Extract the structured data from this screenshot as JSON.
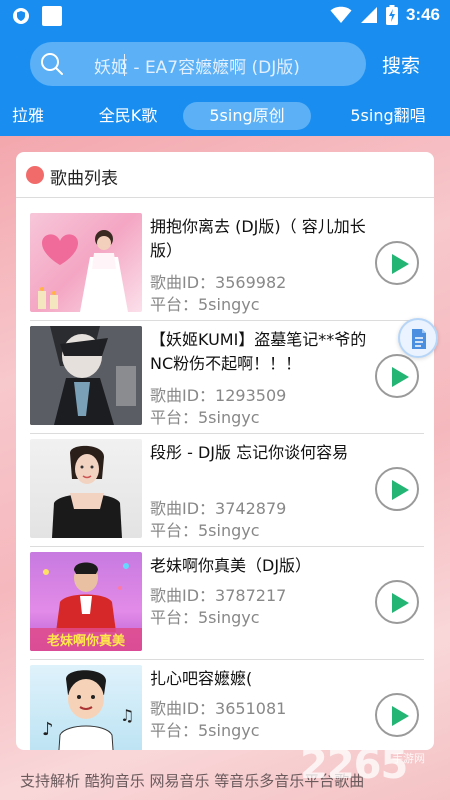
{
  "status_bar": {
    "time": "3:46",
    "icons": [
      "shield-icon",
      "square-icon",
      "wifi-icon",
      "signal-icon",
      "battery-charging-icon"
    ]
  },
  "search": {
    "query": "妖姬 - EA7容嬷嬷啊 (DJ版)",
    "button_label": "搜索",
    "icon": "search-icon"
  },
  "tabs": [
    {
      "label": "拉雅",
      "active": false
    },
    {
      "label": "全民K歌",
      "active": false
    },
    {
      "label": "5sing原创",
      "active": true
    },
    {
      "label": "5sing翻唱",
      "active": false
    }
  ],
  "song_list": {
    "title": "歌曲列表",
    "items": [
      {
        "title": "拥抱你离去 (DJ版)（ 容儿加长版）",
        "id_text": "歌曲ID：3569982",
        "platform_text": "平台：5singyc"
      },
      {
        "title": "【妖姬KUMI】盗墓笔记**爷的NC粉伤不起啊！！！",
        "id_text": "歌曲ID：1293509",
        "platform_text": "平台：5singyc"
      },
      {
        "title": "段彤 - DJ版 忘记你谈何容易",
        "id_text": "歌曲ID：3742879",
        "platform_text": "平台：5singyc"
      },
      {
        "title": "老妹啊你真美（DJ版）",
        "id_text": "歌曲ID：3787217",
        "platform_text": "平台：5singyc"
      },
      {
        "title": "扎心吧容嬷嬷(",
        "id_text": "歌曲ID：3651081",
        "platform_text": "平台：5singyc"
      }
    ]
  },
  "footer": {
    "text": "支持解析 酷狗音乐 网易音乐 等音乐多音乐平台歌曲"
  },
  "watermark": {
    "main": "2265",
    "sub": "手游网"
  },
  "thumb_captions": {
    "item4": "老妹啊你真美"
  },
  "colors": {
    "primary": "#1a8ef0",
    "play_green": "#22b573",
    "accent_dot": "#f26b6b"
  }
}
